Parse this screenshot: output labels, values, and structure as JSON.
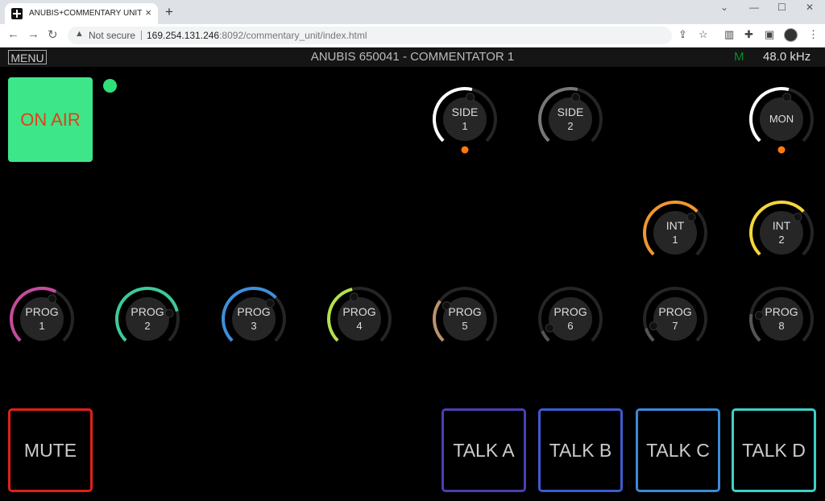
{
  "browser": {
    "tab_title": "ANUBIS+COMMENTARY UNIT",
    "tab_close": "×",
    "new_tab": "+",
    "not_secure": "Not secure",
    "url_host": "169.254.131.246",
    "url_rest": ":8092/commentary_unit/index.html"
  },
  "header": {
    "menu_label": "MENU",
    "title": "ANUBIS 650041 - COMMENTATOR 1",
    "indicator": "M",
    "sample_rate": "48.0 kHz"
  },
  "on_air_label": "ON AIR",
  "knobs": [
    {
      "id": "side-1",
      "line1": "SIDE",
      "line2": "1",
      "color": "#ffffff",
      "level": 0.55,
      "orange_dot": true
    },
    {
      "id": "side-2",
      "line1": "SIDE",
      "line2": "2",
      "color": "#777777",
      "level": 0.55,
      "orange_dot": false
    },
    {
      "id": "mon",
      "line1": "MON",
      "line2": "",
      "color": "#ffffff",
      "level": 0.55,
      "orange_dot": true
    },
    {
      "id": "int-1",
      "line1": "INT",
      "line2": "1",
      "color": "#f0972e",
      "level": 0.67,
      "orange_dot": false
    },
    {
      "id": "int-2",
      "line1": "INT",
      "line2": "2",
      "color": "#f5d63a",
      "level": 0.67,
      "orange_dot": false
    },
    {
      "id": "prog-1",
      "line1": "PROG",
      "line2": "1",
      "color": "#c54b9c",
      "level": 0.6,
      "orange_dot": false
    },
    {
      "id": "prog-2",
      "line1": "PROG",
      "line2": "2",
      "color": "#3ec99a",
      "level": 0.78,
      "orange_dot": false
    },
    {
      "id": "prog-3",
      "line1": "PROG",
      "line2": "3",
      "color": "#3f8fdb",
      "level": 0.67,
      "orange_dot": false
    },
    {
      "id": "prog-4",
      "line1": "PROG",
      "line2": "4",
      "color": "#b5e04a",
      "level": 0.45,
      "orange_dot": false
    },
    {
      "id": "prog-5",
      "line1": "PROG",
      "line2": "5",
      "color": "#b9926a",
      "level": 0.3,
      "orange_dot": false
    },
    {
      "id": "prog-6",
      "line1": "PROG",
      "line2": "6",
      "color": "#555555",
      "level": 0.08,
      "orange_dot": false
    },
    {
      "id": "prog-7",
      "line1": "PROG",
      "line2": "7",
      "color": "#555555",
      "level": 0.1,
      "orange_dot": false
    },
    {
      "id": "prog-8",
      "line1": "PROG",
      "line2": "8",
      "color": "#555555",
      "level": 0.2,
      "orange_dot": false
    }
  ],
  "buttons": {
    "mute": {
      "label": "MUTE",
      "color": "#e0201a"
    },
    "talk_a": {
      "label": "TALK A",
      "color": "#4a3fb5"
    },
    "talk_b": {
      "label": "TALK B",
      "color": "#3d5bd0"
    },
    "talk_c": {
      "label": "TALK C",
      "color": "#3a8ad8"
    },
    "talk_d": {
      "label": "TALK D",
      "color": "#3ed0c8"
    }
  }
}
